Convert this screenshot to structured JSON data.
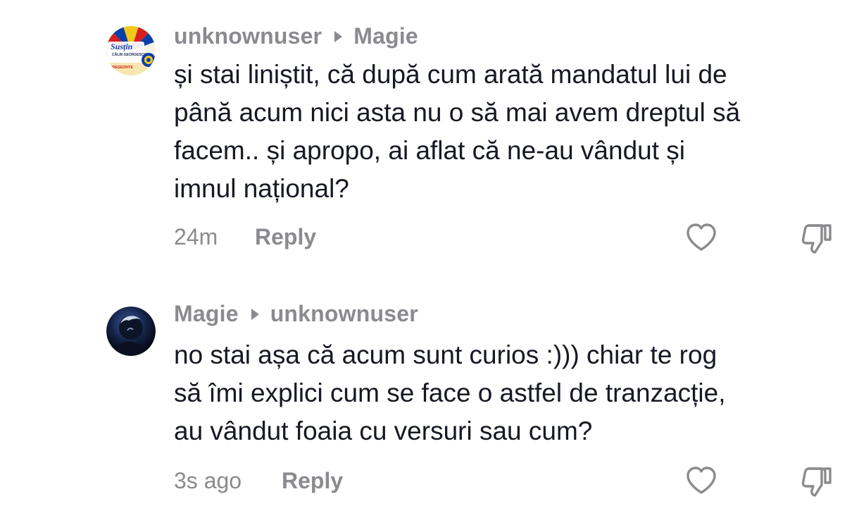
{
  "comments": [
    {
      "author": "unknownuser",
      "reply_to": "Magie",
      "text": "și stai liniștit, că după cum arată mandatul lui de\npână acum nici asta nu o să mai avem dreptul să\nfacem.. și apropo, ai aflat că ne-au vândut și\nimnul național?",
      "time": "24m",
      "reply_label": "Reply",
      "avatar_badge": {
        "text": "Susțin",
        "subtext": "CĂLIN GEORGESCU",
        "footer": "PREȘEDINTE",
        "colors": [
          "#0b3fa8",
          "#f2c81b",
          "#d6201f"
        ]
      }
    },
    {
      "author": "Magie",
      "reply_to": "unknownuser",
      "text": "no stai așa că acum sunt curios :))) chiar te rog\nsă îmi explici cum se face o astfel de tranzacție,\nau vândut foaia cu versuri sau cum?",
      "time": "3s ago",
      "reply_label": "Reply",
      "avatar_badge": {
        "colors": [
          "#0a0f1e",
          "#2a4a8a",
          "#cfd9ee"
        ]
      }
    }
  ],
  "icons": {
    "like": "heart-outline-icon",
    "dislike": "thumbs-down-outline-icon"
  },
  "colors": {
    "text": "#161823",
    "muted": "#8a8a8f",
    "background": "#ffffff"
  }
}
